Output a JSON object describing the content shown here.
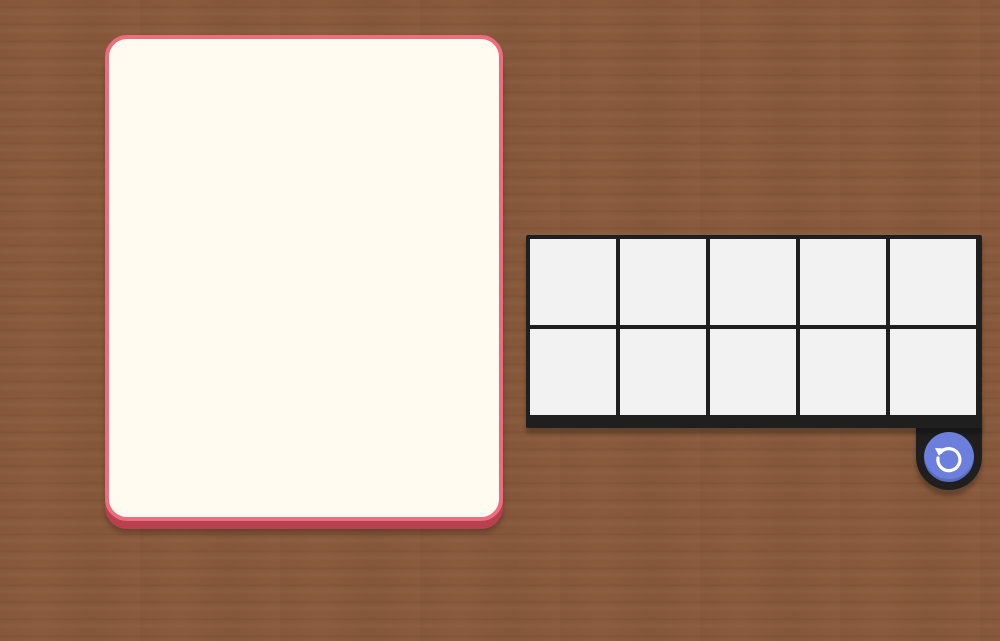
{
  "card": {
    "content": ""
  },
  "ten_frame": {
    "rows": 2,
    "columns": 5,
    "filled_cells": 0
  },
  "reset_button": {
    "icon": "reset-icon",
    "accent_color": "#6c7fdd"
  },
  "colors": {
    "card_border": "#ec6d7e",
    "card_background": "#fffbf0",
    "frame": "#1f1f1f",
    "cell_empty": "#f2f2f2",
    "table_wood": "#8a5a3c"
  }
}
